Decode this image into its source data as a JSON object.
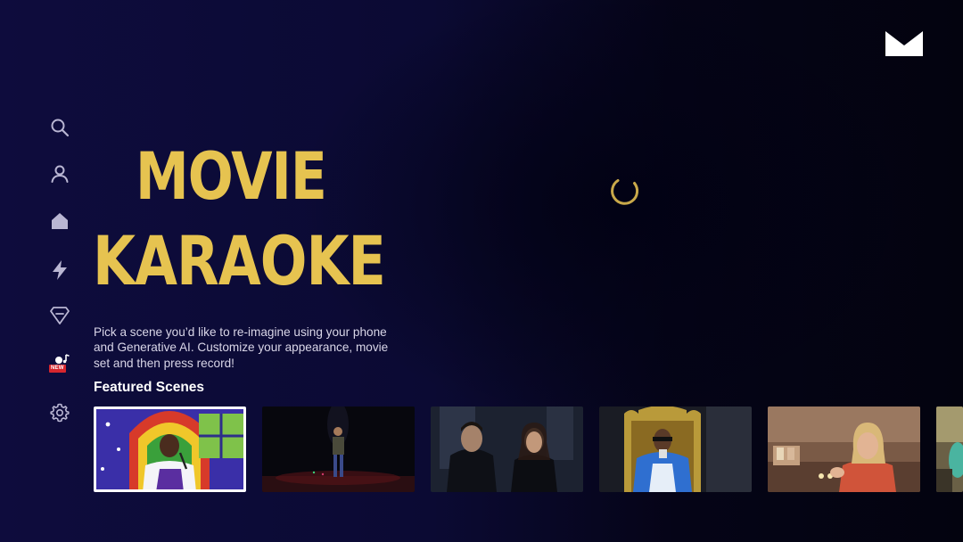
{
  "brand": {
    "logo_icon": "envelope-logo-icon"
  },
  "sidebar": {
    "items": [
      {
        "name": "search",
        "icon": "search-icon"
      },
      {
        "name": "profile",
        "icon": "user-icon"
      },
      {
        "name": "home",
        "icon": "home-icon"
      },
      {
        "name": "lightning",
        "icon": "lightning-icon"
      },
      {
        "name": "gem",
        "icon": "gem-icon"
      },
      {
        "name": "movie-karaoke",
        "icon": "singer-note-icon",
        "badge": "NEW"
      },
      {
        "name": "settings",
        "icon": "gear-icon"
      }
    ]
  },
  "hero": {
    "title_line1": "MOVIE",
    "title_line2": "KARAOKE",
    "description": "Pick a scene you’d like to re-imagine using your phone and Generative AI. Customize your appearance, movie set and then press record!"
  },
  "featured": {
    "heading": "Featured Scenes",
    "scenes": [
      {
        "id": "scene-1",
        "selected": true
      },
      {
        "id": "scene-2",
        "selected": false
      },
      {
        "id": "scene-3",
        "selected": false
      },
      {
        "id": "scene-4",
        "selected": false
      },
      {
        "id": "scene-5",
        "selected": false
      },
      {
        "id": "scene-6",
        "selected": false
      }
    ]
  },
  "colors": {
    "accent": "#e6c350",
    "background": "#0d0b3a",
    "badge": "#d7262e",
    "icon": "#b9b6d3"
  },
  "loading": {
    "icon": "loading-spinner-icon"
  }
}
